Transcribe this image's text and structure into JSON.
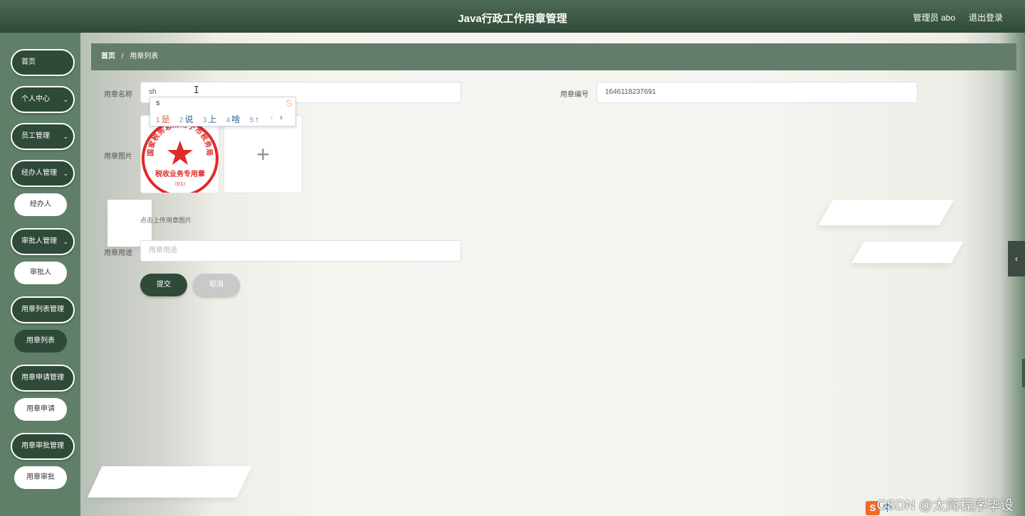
{
  "header": {
    "title": "Java行政工作用章管理",
    "user": "管理员 abo",
    "logout": "退出登录"
  },
  "sidebar": {
    "items": [
      {
        "label": "首页",
        "has_arrow": false
      },
      {
        "label": "个人中心",
        "has_arrow": true
      },
      {
        "label": "员工管理",
        "has_arrow": true
      },
      {
        "label": "经办人管理",
        "has_arrow": true,
        "sub": "经办人"
      },
      {
        "label": "审批人管理",
        "has_arrow": true,
        "sub": "审批人"
      },
      {
        "label": "用章列表管理",
        "has_arrow": true,
        "sub": "用章列表",
        "active": true
      },
      {
        "label": "用章申请管理",
        "has_arrow": true,
        "sub": "用章申请"
      },
      {
        "label": "用章审批管理",
        "has_arrow": true,
        "sub": "用章审批"
      }
    ]
  },
  "breadcrumb": {
    "home": "首页",
    "separator": "/",
    "current": "用章列表"
  },
  "form": {
    "name_label": "用章名称",
    "name_value": "sh",
    "code_label": "用章编号",
    "code_value": "1646118237691",
    "image_label": "用章图片",
    "upload_tip": "点击上传用章图片",
    "usage_label": "用章用途",
    "usage_placeholder": "用章用途",
    "submit": "提交",
    "cancel": "取消"
  },
  "seal": {
    "ring_text": "国家税务总局南宁市税务局",
    "center_text": "税收业务专用章",
    "number": "(01)",
    "color": "#e02a2a"
  },
  "ime": {
    "pinyin": "s",
    "candidates": [
      {
        "n": "1",
        "text": "是"
      },
      {
        "n": "2",
        "text": "说"
      },
      {
        "n": "3",
        "text": "上"
      },
      {
        "n": "4",
        "text": "啥"
      },
      {
        "n": "5",
        "text": "↑"
      }
    ],
    "logo": "S",
    "prev": "‹",
    "next": "›"
  },
  "taskbar": {
    "ime_label": "中",
    "watermark": "CSDN @太简程序毕设"
  },
  "colors": {
    "header": "#2f4a38",
    "sidebar": "#5f7f68",
    "breadcrumb": "#647d6b",
    "button_dark": "#2f4a38",
    "seal_red": "#e02a2a"
  }
}
